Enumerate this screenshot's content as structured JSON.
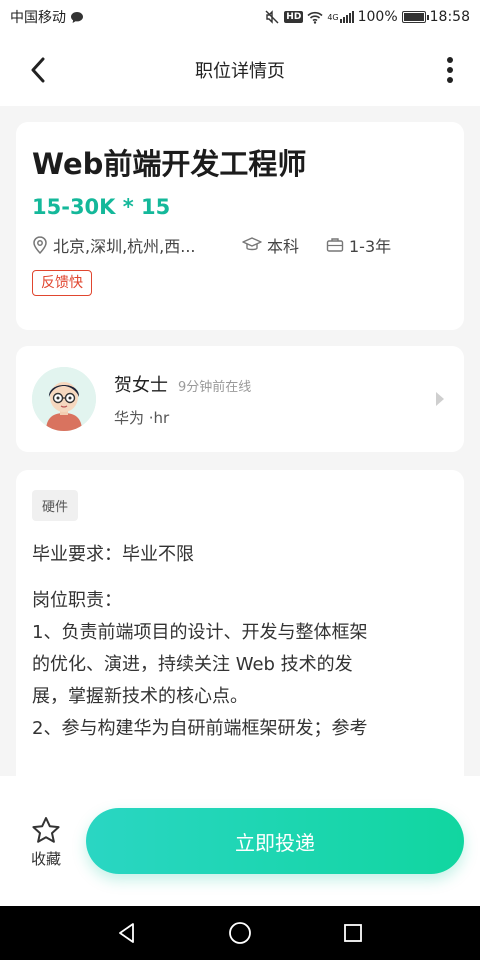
{
  "status_bar": {
    "carrier": "中国移动",
    "signal_label": "4G",
    "battery": "100%",
    "time": "18:58",
    "icons": [
      "chat-bubble-icon",
      "mute-icon",
      "hd-icon",
      "wifi-icon",
      "cell-signal-icon",
      "battery-icon"
    ]
  },
  "header": {
    "title": "职位详情页",
    "back_icon": "chevron-left-icon",
    "more_icon": "more-vertical-icon"
  },
  "job": {
    "title": "Web前端开发工程师",
    "salary": "15-30K * 15",
    "location": "北京,深圳,杭州,西...",
    "education": "本科",
    "experience": "1-3年",
    "tag": "反馈快",
    "colors": {
      "salary": "#14b89a",
      "tag": "#e0462f"
    }
  },
  "recruiter": {
    "name": "贺女士",
    "online": "9分钟前在线",
    "company": "华为 ·hr"
  },
  "description": {
    "tag": "硬件",
    "requirement": "毕业要求：毕业不限",
    "duties_title": "岗位职责：",
    "lines": [
      "1、负责前端项目的设计、开发与整体框架",
      "的优化、演进，持续关注 Web 技术的发",
      "展，掌握新技术的核心点。",
      "2、参与构建华为自研前端框架研发；参考"
    ]
  },
  "bottom": {
    "favorite_label": "收藏",
    "apply_label": "立即投递",
    "accent_gradient": [
      "#2ad6c3",
      "#11d6a0"
    ]
  },
  "nav": {
    "icons": [
      "back-triangle-icon",
      "home-circle-icon",
      "recents-square-icon"
    ]
  }
}
